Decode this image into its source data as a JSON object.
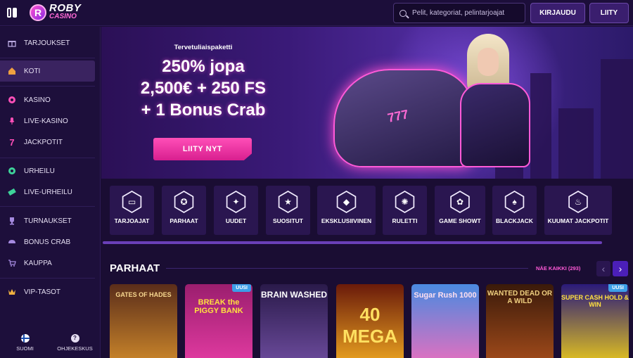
{
  "header": {
    "logo_top": "ROBY",
    "logo_bottom": "CASINO",
    "logo_badge": "R",
    "search_placeholder": "Pelit, kategoriat, pelintarjoajat",
    "login_label": "KIRJAUDU",
    "join_label": "LIITY"
  },
  "sidebar": {
    "items": [
      {
        "label": "TARJOUKSET",
        "icon": "gift-icon"
      },
      {
        "label": "KOTI",
        "icon": "home-icon"
      },
      {
        "label": "KASINO",
        "icon": "chip-icon"
      },
      {
        "label": "LIVE-KASINO",
        "icon": "microphone-icon"
      },
      {
        "label": "JACKPOTIT",
        "icon": "seven-icon"
      },
      {
        "label": "URHEILU",
        "icon": "football-icon"
      },
      {
        "label": "LIVE-URHEILU",
        "icon": "ticket-icon"
      },
      {
        "label": "TURNAUKSET",
        "icon": "trophy-icon"
      },
      {
        "label": "BONUS CRAB",
        "icon": "crab-icon"
      },
      {
        "label": "KAUPPA",
        "icon": "cart-icon"
      },
      {
        "label": "VIP-TASOT",
        "icon": "crown-icon"
      }
    ],
    "language_label": "SUOMI",
    "help_label": "OHJEKESKUS",
    "help_glyph": "?"
  },
  "hero": {
    "eyebrow": "Tervetuliaispaketti",
    "line1": "250% jopa",
    "line2": "2,500€ + 250 FS",
    "line3": "+ 1 Bonus Crab",
    "cta": "LIITY NYT",
    "plate": "777"
  },
  "categories": [
    {
      "label": "TARJOAJAT",
      "icon": "folder-icon",
      "glyph": "▭"
    },
    {
      "label": "PARHAAT",
      "icon": "medal-icon",
      "glyph": "✪"
    },
    {
      "label": "UUDET",
      "icon": "sparkle-icon",
      "glyph": "✦"
    },
    {
      "label": "SUOSITUT",
      "icon": "star-icon",
      "glyph": "★"
    },
    {
      "label": "EKSKLUSIIVINEN",
      "icon": "diamond-icon",
      "glyph": "◆"
    },
    {
      "label": "RULETTI",
      "icon": "roulette-icon",
      "glyph": "✺"
    },
    {
      "label": "GAME SHOWT",
      "icon": "wheel-icon",
      "glyph": "✿"
    },
    {
      "label": "BLACKJACK",
      "icon": "spade-icon",
      "glyph": "♠"
    },
    {
      "label": "KUUMAT JACKPOTIT",
      "icon": "flame-icon",
      "glyph": "♨"
    }
  ],
  "section": {
    "title": "PARHAAT",
    "see_all": "NÄE KAIKKI (293)",
    "prev": "‹",
    "next": "›"
  },
  "games": [
    {
      "title": "GATES OF HADES",
      "badge": "",
      "colors": [
        "#5a2d1a",
        "#c8842a"
      ]
    },
    {
      "title": "BREAK the PIGGY BANK",
      "badge": "UUSI",
      "colors": [
        "#9b1e6e",
        "#e03aa0"
      ]
    },
    {
      "title": "BRAIN WASHED",
      "badge": "",
      "colors": [
        "#2a1a4a",
        "#6a4a9a"
      ]
    },
    {
      "title": "40 MEGA",
      "badge": "",
      "colors": [
        "#6a1a0a",
        "#e8a020"
      ]
    },
    {
      "title": "Sugar Rush 1000",
      "badge": "",
      "colors": [
        "#4a8ae0",
        "#e070c0"
      ]
    },
    {
      "title": "WANTED DEAD OR A WILD",
      "badge": "",
      "colors": [
        "#3a1a0a",
        "#a04a1a"
      ]
    },
    {
      "title": "SUPER CASH HOLD & WIN",
      "badge": "UUSI",
      "colors": [
        "#2a1a7a",
        "#e0c020"
      ]
    }
  ]
}
